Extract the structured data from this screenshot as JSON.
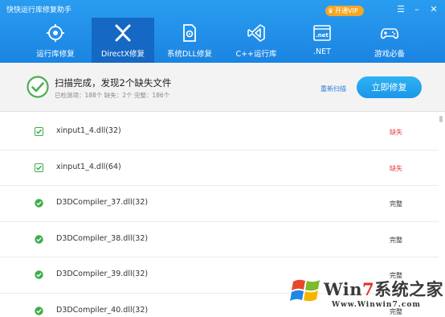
{
  "app": {
    "title": "快快运行库修复助手"
  },
  "window_controls": {
    "vip_label": "开通VIP",
    "vip_icon": "crown-icon",
    "menu_icon": "menu-icon",
    "minimize_icon": "minimize-icon",
    "close_icon": "close-icon"
  },
  "tabs": [
    {
      "label": "运行库修复",
      "icon": "runtime-repair-icon"
    },
    {
      "label": "DirectX修复",
      "icon": "directx-icon",
      "active": true
    },
    {
      "label": "系统DLL修复",
      "icon": "dll-file-icon"
    },
    {
      "label": "C++运行库",
      "icon": "visual-studio-icon"
    },
    {
      "label": ".NET",
      "icon": "dotnet-icon"
    },
    {
      "label": "游戏必备",
      "icon": "gamepad-icon"
    }
  ],
  "status": {
    "title": "扫描完成，发现2个缺失文件",
    "detail": "已检测项：188个   缺失：2个   完整：186个",
    "rescan_label": "重新扫描",
    "repair_label": "立即修复"
  },
  "files": [
    {
      "name": "xinput1_4.dll(32)",
      "status": "缺失",
      "missing": true
    },
    {
      "name": "xinput1_4.dll(64)",
      "status": "缺失",
      "missing": true
    },
    {
      "name": "D3DCompiler_37.dll(32)",
      "status": "完整",
      "missing": false
    },
    {
      "name": "D3DCompiler_38.dll(32)",
      "status": "完整",
      "missing": false
    },
    {
      "name": "D3DCompiler_39.dll(32)",
      "status": "完整",
      "missing": false
    },
    {
      "name": "D3DCompiler_40.dll(32)",
      "status": "完整",
      "missing": false
    }
  ],
  "watermark": {
    "brand_prefix": "Win",
    "brand_seven": "7",
    "brand_suffix": "系统之家",
    "url": "Www.Winwin7.com"
  },
  "colors": {
    "header": "#1b84e2",
    "active_tab": "#1568c3",
    "missing": "#e53935",
    "ok_check": "#3cae4b",
    "vip": "#f5a623"
  }
}
